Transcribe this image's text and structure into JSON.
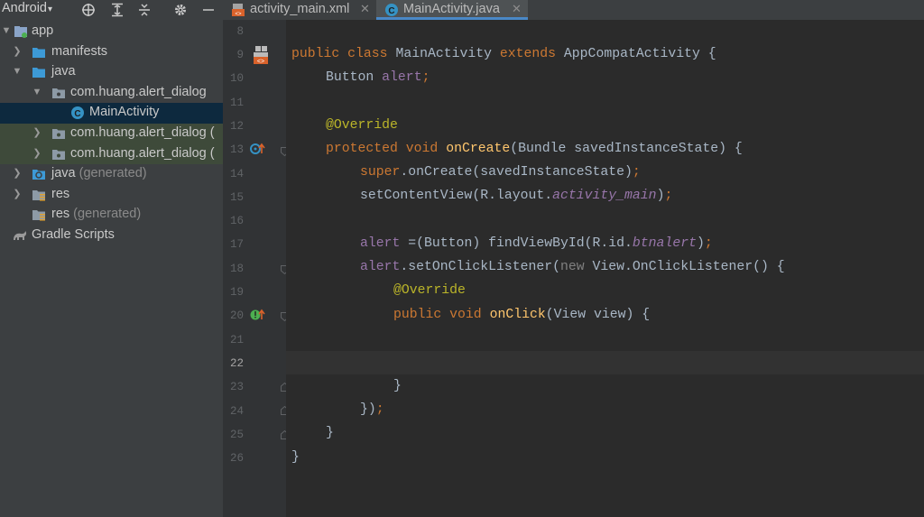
{
  "project_panel": {
    "view_label": "Android",
    "tree": [
      {
        "label": "app",
        "suffix": "",
        "icon": "module-icon",
        "expanded": true
      },
      {
        "label": "manifests",
        "suffix": "",
        "icon": "folder-icon",
        "expanded": false
      },
      {
        "label": "java",
        "suffix": "",
        "icon": "folder-icon",
        "expanded": true
      },
      {
        "label": "com.huang.alert_dialog",
        "suffix": "",
        "icon": "package-icon",
        "expanded": true
      },
      {
        "label": "MainActivity",
        "suffix": "",
        "icon": "class-icon",
        "selected": true
      },
      {
        "label": "com.huang.alert_dialog (",
        "suffix": "",
        "icon": "package-icon",
        "expanded": false
      },
      {
        "label": "com.huang.alert_dialog (",
        "suffix": "",
        "icon": "package-icon",
        "expanded": false
      },
      {
        "label": "java",
        "suffix": " (generated)",
        "icon": "generated-folder-icon",
        "expanded": false
      },
      {
        "label": "res",
        "suffix": "",
        "icon": "res-folder-icon",
        "expanded": false
      },
      {
        "label": "res",
        "suffix": " (generated)",
        "icon": "res-folder-icon"
      },
      {
        "label": "Gradle Scripts",
        "suffix": "",
        "icon": "gradle-icon"
      }
    ]
  },
  "tabs": [
    {
      "label": "activity_main.xml",
      "icon": "xml-file-icon",
      "active": false
    },
    {
      "label": "MainActivity.java",
      "icon": "class-icon",
      "active": true
    }
  ],
  "editor": {
    "current_line": 22,
    "line_numbers": [
      "8",
      "9",
      "10",
      "11",
      "12",
      "13",
      "14",
      "15",
      "16",
      "17",
      "18",
      "19",
      "20",
      "21",
      "22",
      "23",
      "24",
      "25",
      "26"
    ],
    "code": {
      "l9": [
        "public class ",
        "MainActivity ",
        "extends ",
        "AppCompatActivity {"
      ],
      "l10": [
        "Button ",
        "alert",
        ";"
      ],
      "l12": [
        "@Override"
      ],
      "l13": [
        "protected void ",
        "onCreate",
        "(Bundle savedInstanceState) {"
      ],
      "l14": [
        "super",
        ".onCreate(savedInstanceState)",
        ";"
      ],
      "l15": [
        "setContentView(R.layout.",
        "activity_main",
        ")",
        ";"
      ],
      "l17": [
        "alert ",
        "=(Button) findViewById(R.id.",
        "btnalert",
        ")",
        ";"
      ],
      "l18": [
        "alert",
        ".setOnClickListener(",
        "new ",
        "View.OnClickListener() {"
      ],
      "l19": [
        "@Override"
      ],
      "l20": [
        "public void ",
        "onClick",
        "(View view) {"
      ],
      "l23": [
        "}"
      ],
      "l24": [
        "})",
        ";"
      ],
      "l25": [
        "}"
      ],
      "l26": [
        "}"
      ]
    }
  }
}
